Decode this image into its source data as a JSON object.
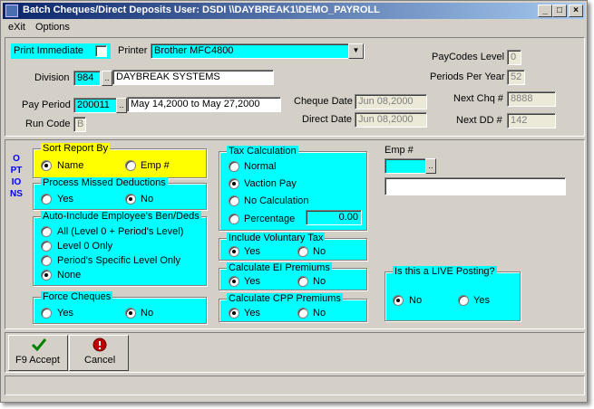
{
  "window": {
    "title": "Batch Cheques/Direct Deposits  User: DSDI  \\\\DAYBREAK1\\DEMO_PAYROLL"
  },
  "menu": {
    "exit": "eXit",
    "options": "Options"
  },
  "header": {
    "print_immediate": "Print Immediate",
    "printer_label": "Printer",
    "printer_value": "Brother MFC4800",
    "division_label": "Division",
    "division_code": "984",
    "division_name": "DAYBREAK SYSTEMS",
    "pay_period_label": "Pay Period",
    "pay_period_code": "200011",
    "pay_period_range": "May 14,2000 to May 27,2000",
    "run_code_label": "Run Code",
    "run_code_value": "B",
    "cheque_date_label": "Cheque Date",
    "cheque_date_value": "Jun 08,2000",
    "direct_date_label": "Direct Date",
    "direct_date_value": "Jun 08,2000",
    "paycodes_level_label": "PayCodes Level",
    "paycodes_level_value": "0",
    "periods_per_year_label": "Periods Per Year",
    "periods_per_year_value": "52",
    "next_chq_label": "Next Chq #",
    "next_chq_value": "8888",
    "next_dd_label": "Next DD #",
    "next_dd_value": "142"
  },
  "options": {
    "side_label": "OPTIONS",
    "sort_report": {
      "title": "Sort Report By",
      "name": "Name",
      "emp": "Emp #"
    },
    "process_missed": {
      "title": "Process Missed Deductions",
      "yes": "Yes",
      "no": "No"
    },
    "auto_include": {
      "title": "Auto-Include Employee's Ben/Deds",
      "all": "All (Level 0 + Period's Level)",
      "level0": "Level 0 Only",
      "period_specific": "Period's Specific Level Only",
      "none": "None"
    },
    "force_cheques": {
      "title": "Force Cheques",
      "yes": "Yes",
      "no": "No"
    },
    "tax_calc": {
      "title": "Tax Calculation",
      "normal": "Normal",
      "vacation": "Vaction Pay",
      "no_calc": "No Calculation",
      "percentage": "Percentage",
      "percentage_value": "0.00"
    },
    "voluntary_tax": {
      "title": "Include Voluntary Tax",
      "yes": "Yes",
      "no": "No"
    },
    "ei_premiums": {
      "title": "Calculate EI Premiums",
      "yes": "Yes",
      "no": "No"
    },
    "cpp_premiums": {
      "title": "Calculate CPP Premiums",
      "yes": "Yes",
      "no": "No"
    },
    "emp_label": "Emp #",
    "live_posting": {
      "title": "Is this a LIVE Posting?",
      "no": "No",
      "yes": "Yes"
    }
  },
  "buttons": {
    "accept": "F9 Accept",
    "cancel": "Cancel"
  },
  "colors": {
    "titlebar_start": "#0a246a",
    "cyan": "#00ffff",
    "yellow": "#ffff00",
    "options_label": "#0000ff"
  }
}
